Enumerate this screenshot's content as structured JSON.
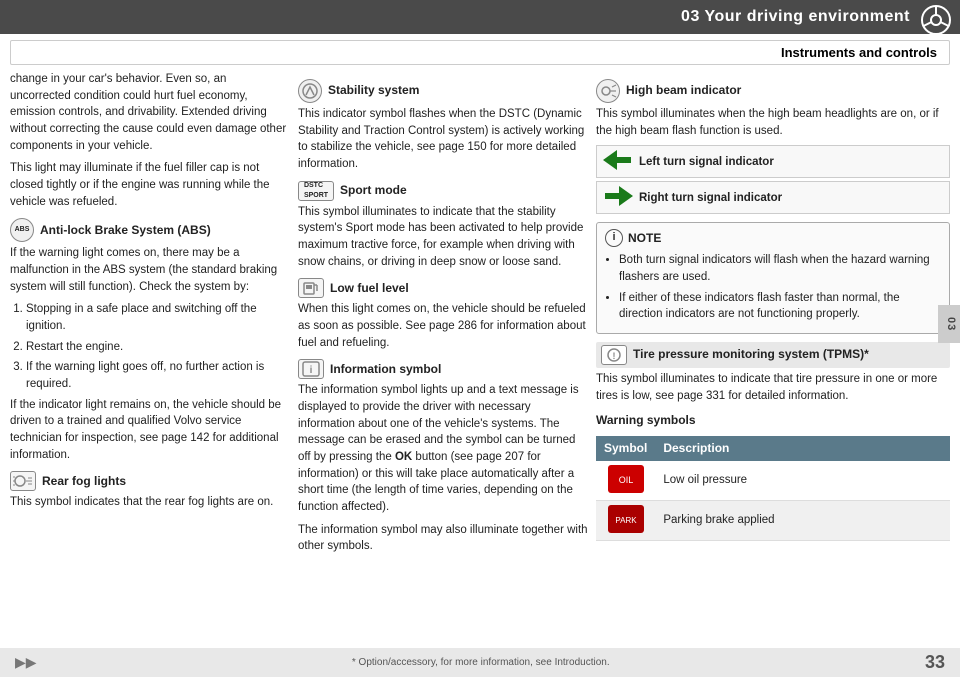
{
  "header": {
    "title": "03 Your driving environment",
    "icon": "steering-wheel-icon"
  },
  "section_title": "Instruments and controls",
  "page_tab": "03",
  "left_column": {
    "intro_text_1": "change in your car's behavior. Even so, an uncorrected condition could hurt fuel economy, emission controls, and drivability. Extended driving without correcting the cause could even damage other components in your vehicle.",
    "intro_text_2": "This light may illuminate if the fuel filler cap is not closed tightly or if the engine was running while the vehicle was refueled.",
    "abs_section": {
      "icon_label": "ABS",
      "title": "Anti-lock Brake System (ABS)",
      "text_1": "If the warning light comes on, there may be a malfunction in the ABS system (the standard braking system will still function). Check the system by:",
      "steps": [
        "Stopping in a safe place and switching off the ignition.",
        "Restart the engine.",
        "If the warning light goes off, no further action is required."
      ],
      "text_2": "If the indicator light remains on, the vehicle should be driven to a trained and qualified Volvo service technician for inspection, see page 142 for additional information."
    },
    "rear_fog_section": {
      "icon_label": "FOG",
      "title": "Rear fog lights",
      "text": "This symbol indicates that the rear fog lights are on."
    }
  },
  "mid_column": {
    "stability_section": {
      "icon_label": "DSC",
      "title": "Stability system",
      "text": "This indicator symbol flashes when the DSTC (Dynamic Stability and Traction Control system) is actively working to stabilize the vehicle, see page 150 for more detailed information."
    },
    "sport_section": {
      "icon_label": "DSTC SPORT",
      "title": "Sport mode",
      "text": "This symbol illuminates to indicate that the stability system's Sport mode has been activated to help provide maximum tractive force, for example when driving with snow chains, or driving in deep snow or loose sand."
    },
    "low_fuel_section": {
      "icon_label": "⛽",
      "title": "Low fuel level",
      "text": "When this light comes on, the vehicle should be refueled as soon as possible. See page 286 for information about fuel and refueling."
    },
    "info_section": {
      "icon_label": "ℹ",
      "title": "Information symbol",
      "text_1": "The information symbol lights up and a text message is displayed to provide the driver with necessary information about one of the vehicle's systems. The message can be erased and the symbol can be turned off by pressing the",
      "ok_button": "OK",
      "text_2": "button (see page 207 for information) or this will take place automatically after a short time (the length of time varies, depending on the function affected).",
      "text_3": "The information symbol may also illuminate together with other symbols."
    }
  },
  "right_column": {
    "highbeam_section": {
      "icon_label": "◎",
      "title": "High beam indicator",
      "text": "This symbol illuminates when the high beam headlights are on, or if the high beam flash function is used."
    },
    "left_turn_signal": {
      "label": "Left turn signal indicator"
    },
    "right_turn_signal": {
      "label": "Right turn signal indicator"
    },
    "note": {
      "title": "NOTE",
      "bullets": [
        "Both turn signal indicators will flash when the hazard warning flashers are used.",
        "If either of these indicators flash faster than normal, the direction indicators are not functioning properly."
      ]
    },
    "tpms_section": {
      "icon_label": "(!)",
      "title": "Tire pressure monitoring system (TPMS)*",
      "text": "This symbol illuminates to indicate that tire pressure in one or more tires is low, see page 331 for detailed information."
    },
    "warning_symbols": {
      "header": "Warning symbols",
      "col_symbol": "Symbol",
      "col_description": "Description",
      "rows": [
        {
          "symbol_label": "oil",
          "description": "Low oil pressure"
        },
        {
          "symbol_label": "PARK",
          "description": "Parking brake applied"
        }
      ]
    }
  },
  "footer": {
    "note_text": "* Option/accessory, for more information, see Introduction.",
    "page_number": "33",
    "arrow_label": "▶▶"
  }
}
